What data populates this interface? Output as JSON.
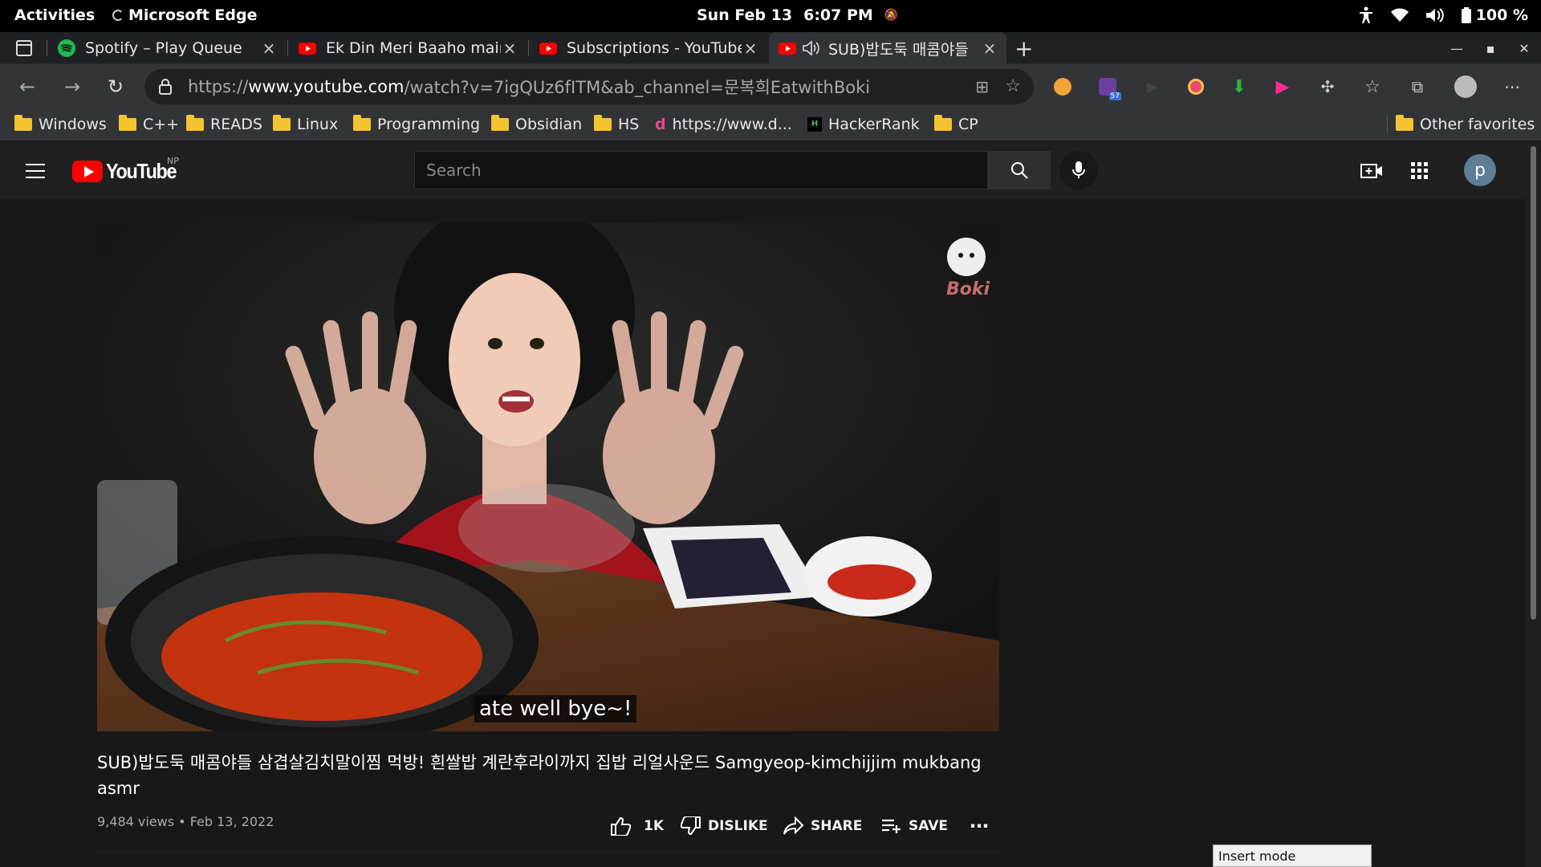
{
  "system_bar": {
    "activities": "Activities",
    "app_name": "Microsoft Edge",
    "date": "Sun Feb 13",
    "time": "6:07 PM",
    "battery": "100 %"
  },
  "tabs": [
    {
      "title": "Spotify – Play Queue",
      "icon": "spotify-icon"
    },
    {
      "title": "Ek Din Meri Baaho main",
      "icon": "youtube-icon"
    },
    {
      "title": "Subscriptions - YouTube",
      "icon": "youtube-icon"
    },
    {
      "title": "SUB)밥도둑 매콤야들",
      "icon": "youtube-icon",
      "active": true
    }
  ],
  "address": {
    "prefix": "https://",
    "host": "www.youtube.com",
    "path": "/watch?v=7igQUz6fITM&ab_channel=문복희EatwithBoki"
  },
  "extensions": {
    "tab_count_badge": "57"
  },
  "bookmarks": [
    {
      "label": "Windows",
      "type": "folder"
    },
    {
      "label": "C++",
      "type": "folder"
    },
    {
      "label": "READS",
      "type": "folder"
    },
    {
      "label": "Linux",
      "type": "folder"
    },
    {
      "label": "Programming",
      "type": "folder"
    },
    {
      "label": "Obsidian",
      "type": "folder"
    },
    {
      "label": "HS",
      "type": "folder"
    },
    {
      "label": "https://www.d...",
      "type": "link"
    },
    {
      "label": "HackerRank",
      "type": "link"
    },
    {
      "label": "CP",
      "type": "folder"
    }
  ],
  "other_favorites": "Other favorites",
  "youtube": {
    "logo_text": "YouTube",
    "region": "NP",
    "search_placeholder": "Search",
    "avatar_letter": "p",
    "video": {
      "caption": "ate well bye~!",
      "watermark": "Boki",
      "title": "SUB)밥도둑 매콤야들 삼겹살김치말이찜 먹방! 흰쌀밥 계란후라이까지 집밥 리얼사운드 Samgyeop-kimchijjim mukbang asmr",
      "views": "9,484 views",
      "date": "Feb 13, 2022",
      "likes": "1K",
      "dislike_label": "DISLIKE",
      "share_label": "SHARE",
      "save_label": "SAVE"
    }
  },
  "insert_mode": "Insert mode",
  "colors": {
    "youtube_red": "#ff0000",
    "folder_yellow": "#f4c430",
    "spotify_green": "#1db954"
  }
}
